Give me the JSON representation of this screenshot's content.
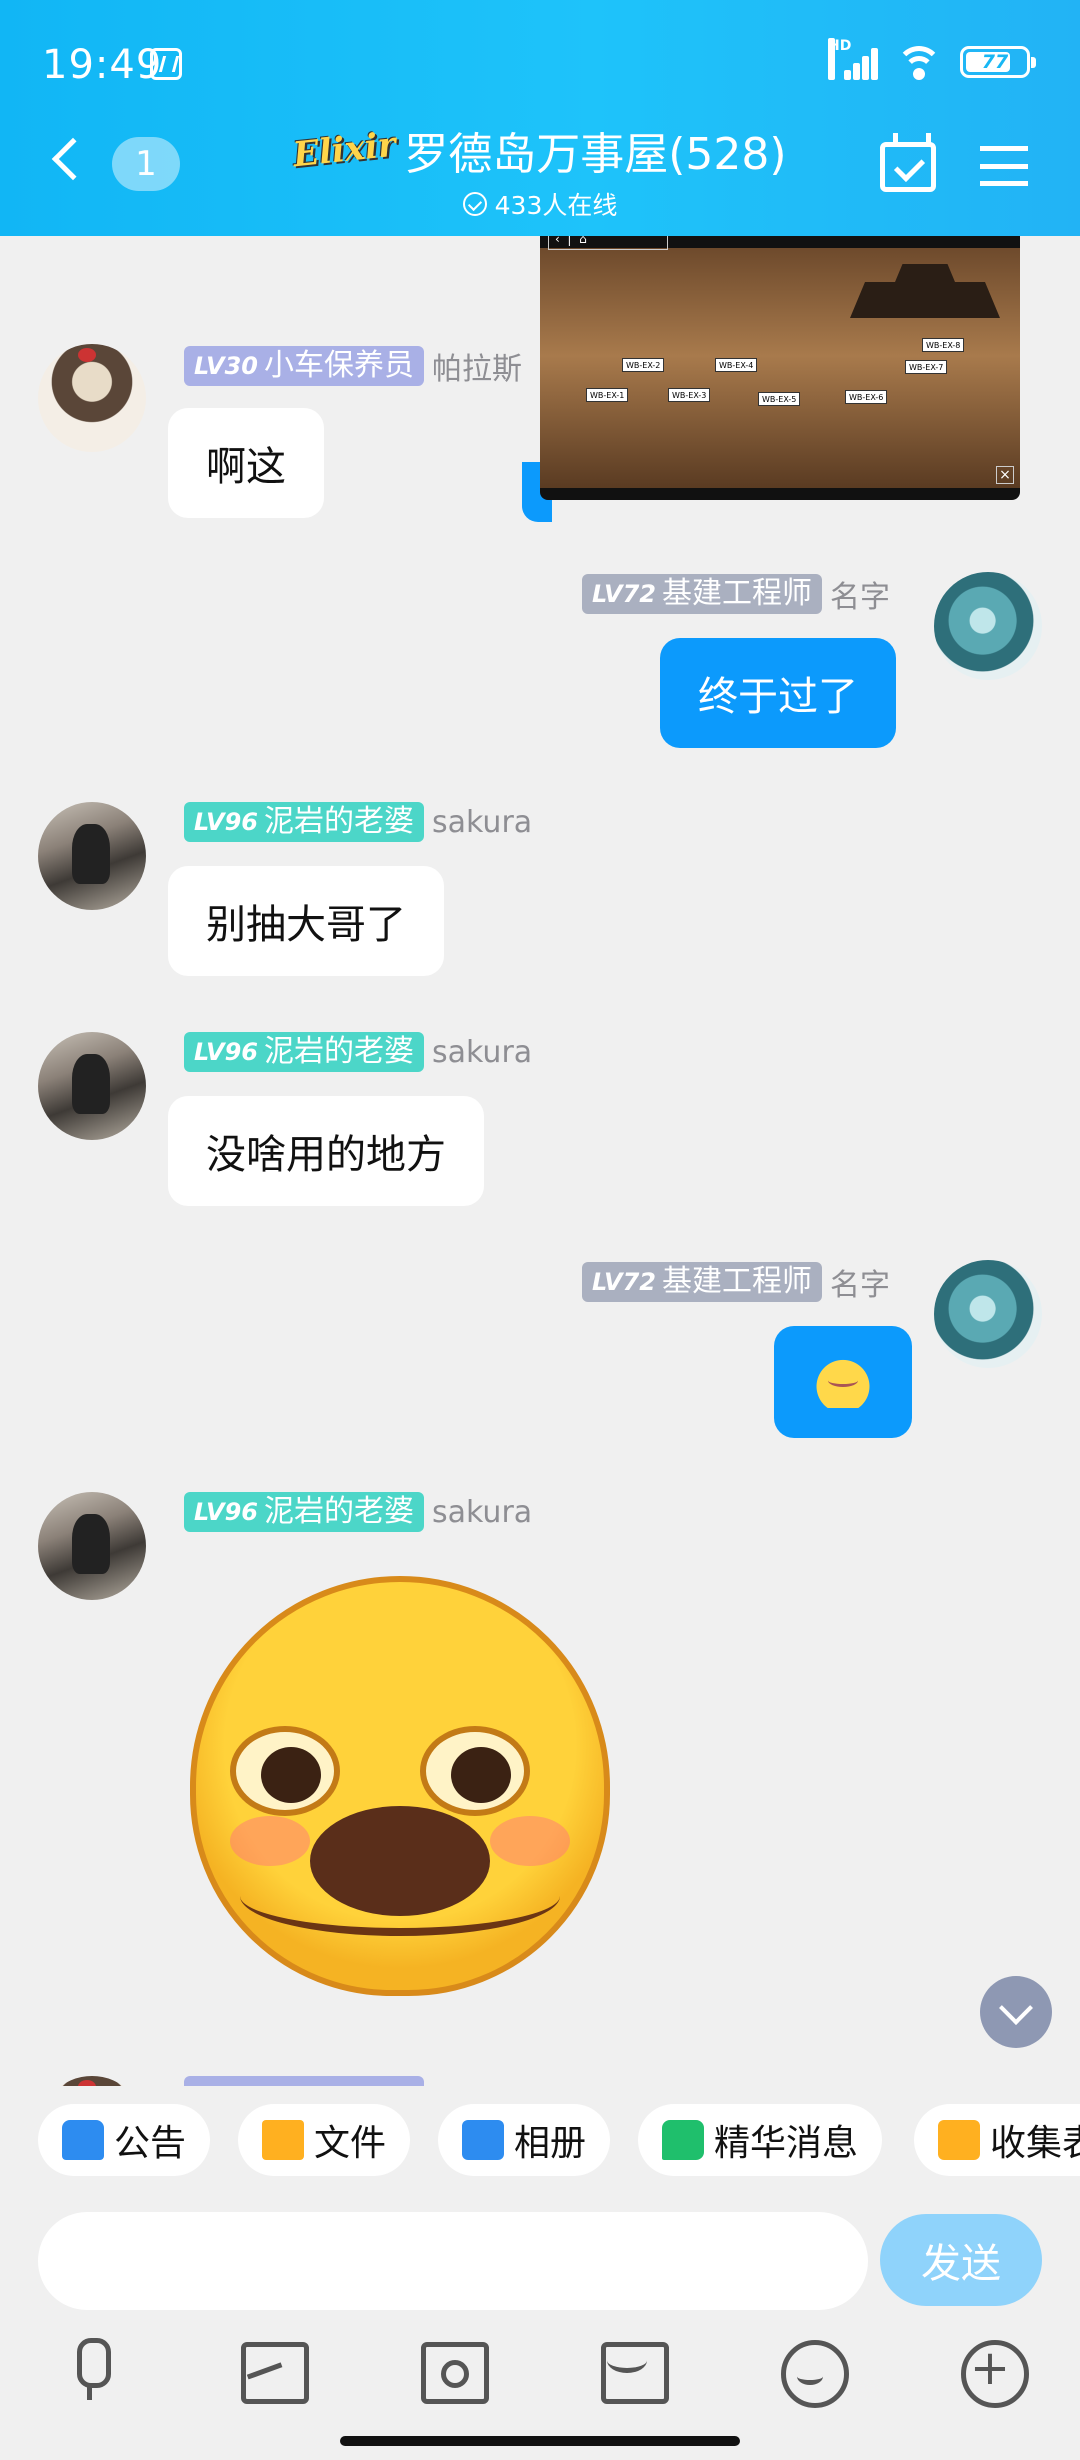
{
  "status_bar": {
    "time": "19:49",
    "network": "HD",
    "battery": "77"
  },
  "header": {
    "unread_count": "1",
    "logo_text": "Elixir",
    "title": "罗德岛万事屋(528)",
    "online": "433人在线"
  },
  "pip": {
    "nodes": [
      "WB-EX-2",
      "WB-EX-4",
      "WB-EX-8",
      "WB-EX-7",
      "WB-EX-1",
      "WB-EX-3",
      "WB-EX-5",
      "WB-EX-6"
    ]
  },
  "messages": [
    {
      "side": "in",
      "level": "LV30",
      "title": "小车保养员",
      "nick": "帕拉斯",
      "text": "啊这",
      "color": "#a9b0e6"
    },
    {
      "side": "out",
      "level": "LV72",
      "title": "基建工程师",
      "nick": "名字",
      "text": "终于过了",
      "color": "#aab0c0"
    },
    {
      "side": "in",
      "level": "LV96",
      "title": "泥岩的老婆",
      "nick": "sakura",
      "text": "别抽大哥了",
      "color": "#4cd6c8"
    },
    {
      "side": "in",
      "level": "LV96",
      "title": "泥岩的老婆",
      "nick": "sakura",
      "text": "没啥用的地方",
      "color": "#4cd6c8"
    },
    {
      "side": "out",
      "level": "LV72",
      "title": "基建工程师",
      "nick": "名字",
      "sticker": "small-yellow-sticker",
      "color": "#aab0c0"
    },
    {
      "side": "in",
      "level": "LV96",
      "title": "泥岩的老婆",
      "nick": "sakura",
      "sticker": "big-yellow-face-sticker",
      "color": "#4cd6c8"
    }
  ],
  "quick_tools": [
    "公告",
    "文件",
    "相册",
    "精华消息",
    "收集表"
  ],
  "input": {
    "placeholder": "",
    "send_label": "发送"
  },
  "actions": [
    "mic-icon",
    "image-icon",
    "camera-icon",
    "red-packet-icon",
    "emoji-icon",
    "plus-icon"
  ]
}
